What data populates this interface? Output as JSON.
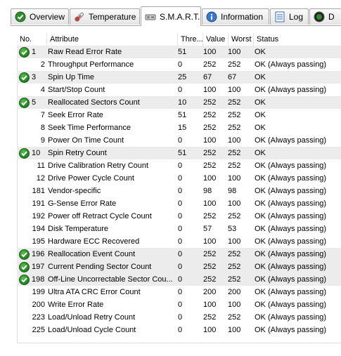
{
  "tabs": [
    {
      "label": "Overview",
      "icon": "check-circle-icon"
    },
    {
      "label": "Temperature",
      "icon": "thermometer-icon"
    },
    {
      "label": "S.M.A.R.T.",
      "icon": "smart-drive-icon",
      "active": true
    },
    {
      "label": "Information",
      "icon": "info-icon"
    },
    {
      "label": "Log",
      "icon": "log-document-icon"
    },
    {
      "label": "D",
      "icon": "gauge-icon"
    }
  ],
  "table": {
    "columns": [
      "No.",
      "Attribute",
      "Thre...",
      "Value",
      "Worst",
      "Status"
    ],
    "rows": [
      {
        "ok": true,
        "no": "1",
        "attr": "Raw Read Error Rate",
        "thr": "51",
        "val": "100",
        "worst": "100",
        "status": "OK"
      },
      {
        "ok": false,
        "no": "2",
        "attr": "Throughput Performance",
        "thr": "0",
        "val": "252",
        "worst": "252",
        "status": "OK (Always passing)"
      },
      {
        "ok": true,
        "no": "3",
        "attr": "Spin Up Time",
        "thr": "25",
        "val": "67",
        "worst": "67",
        "status": "OK"
      },
      {
        "ok": false,
        "no": "4",
        "attr": "Start/Stop Count",
        "thr": "0",
        "val": "100",
        "worst": "100",
        "status": "OK (Always passing)"
      },
      {
        "ok": true,
        "no": "5",
        "attr": "Reallocated Sectors Count",
        "thr": "10",
        "val": "252",
        "worst": "252",
        "status": "OK"
      },
      {
        "ok": false,
        "no": "7",
        "attr": "Seek Error Rate",
        "thr": "51",
        "val": "252",
        "worst": "252",
        "status": "OK"
      },
      {
        "ok": false,
        "no": "8",
        "attr": "Seek Time Performance",
        "thr": "15",
        "val": "252",
        "worst": "252",
        "status": "OK"
      },
      {
        "ok": false,
        "no": "9",
        "attr": "Power On Time Count",
        "thr": "0",
        "val": "100",
        "worst": "100",
        "status": "OK (Always passing)"
      },
      {
        "ok": true,
        "no": "10",
        "attr": "Spin Retry Count",
        "thr": "51",
        "val": "252",
        "worst": "252",
        "status": "OK"
      },
      {
        "ok": false,
        "no": "11",
        "attr": "Drive Calibration Retry Count",
        "thr": "0",
        "val": "252",
        "worst": "252",
        "status": "OK (Always passing)"
      },
      {
        "ok": false,
        "no": "12",
        "attr": "Drive Power Cycle Count",
        "thr": "0",
        "val": "100",
        "worst": "100",
        "status": "OK (Always passing)"
      },
      {
        "ok": false,
        "no": "181",
        "attr": "Vendor-specific",
        "thr": "0",
        "val": "98",
        "worst": "98",
        "status": "OK (Always passing)"
      },
      {
        "ok": false,
        "no": "191",
        "attr": "G-Sense Error Rate",
        "thr": "0",
        "val": "100",
        "worst": "100",
        "status": "OK (Always passing)"
      },
      {
        "ok": false,
        "no": "192",
        "attr": "Power off Retract Cycle Count",
        "thr": "0",
        "val": "252",
        "worst": "252",
        "status": "OK (Always passing)"
      },
      {
        "ok": false,
        "no": "194",
        "attr": "Disk Temperature",
        "thr": "0",
        "val": "57",
        "worst": "53",
        "status": "OK (Always passing)"
      },
      {
        "ok": false,
        "no": "195",
        "attr": "Hardware ECC Recovered",
        "thr": "0",
        "val": "100",
        "worst": "100",
        "status": "OK (Always passing)"
      },
      {
        "ok": true,
        "no": "196",
        "attr": "Reallocation Event Count",
        "thr": "0",
        "val": "252",
        "worst": "252",
        "status": "OK (Always passing)"
      },
      {
        "ok": true,
        "no": "197",
        "attr": "Current Pending Sector Count",
        "thr": "0",
        "val": "252",
        "worst": "252",
        "status": "OK (Always passing)"
      },
      {
        "ok": true,
        "no": "198",
        "attr": "Off-Line Uncorrectable Sector Cou...",
        "thr": "0",
        "val": "252",
        "worst": "252",
        "status": "OK (Always passing)"
      },
      {
        "ok": false,
        "no": "199",
        "attr": "Ultra ATA CRC Error Count",
        "thr": "0",
        "val": "200",
        "worst": "200",
        "status": "OK (Always passing)"
      },
      {
        "ok": false,
        "no": "200",
        "attr": "Write Error Rate",
        "thr": "0",
        "val": "100",
        "worst": "100",
        "status": "OK (Always passing)"
      },
      {
        "ok": false,
        "no": "223",
        "attr": "Load/Unload Retry Count",
        "thr": "0",
        "val": "252",
        "worst": "252",
        "status": "OK (Always passing)"
      },
      {
        "ok": false,
        "no": "225",
        "attr": "Load/Unload Cycle Count",
        "thr": "0",
        "val": "100",
        "worst": "100",
        "status": "OK (Always passing)"
      }
    ]
  },
  "colors": {
    "ok_green": "#2e8b2e",
    "row_shade": "#ececec",
    "border": "#a8a8a8"
  }
}
